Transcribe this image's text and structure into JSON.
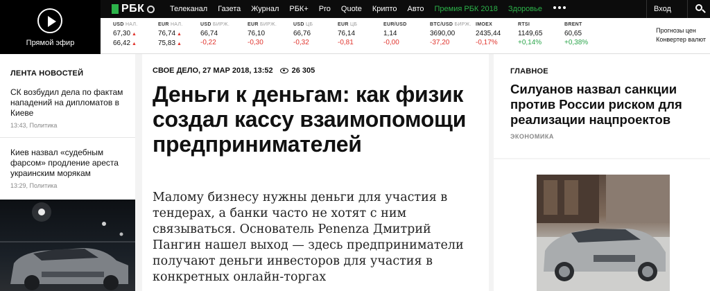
{
  "live": {
    "label": "Прямой эфир"
  },
  "brand": {
    "name": "РБК"
  },
  "nav": {
    "items": [
      "Телеканал",
      "Газета",
      "Журнал",
      "РБК+",
      "Pro",
      "Quote",
      "Крипто",
      "Авто"
    ],
    "promo": [
      "Премия РБК 2018",
      "Здоровье"
    ],
    "login": "Вход"
  },
  "ticker": [
    {
      "name": "USD",
      "src": "НАЛ.",
      "v1": "67,30",
      "v2": "66,42"
    },
    {
      "name": "EUR",
      "src": "НАЛ.",
      "v1": "76,74",
      "v2": "75,83"
    },
    {
      "name": "USD",
      "src": "БИРЖ.",
      "v1": "66,74",
      "v2": "-0,22"
    },
    {
      "name": "EUR",
      "src": "БИРЖ.",
      "v1": "76,10",
      "v2": "-0,30"
    },
    {
      "name": "USD",
      "src": "ЦБ",
      "v1": "66,76",
      "v2": "-0,32"
    },
    {
      "name": "EUR",
      "src": "ЦБ",
      "v1": "76,14",
      "v2": "-0,81"
    },
    {
      "name": "EUR/USD",
      "src": "",
      "v1": "1,14",
      "v2": "-0,00"
    },
    {
      "name": "BTC/USD",
      "src": "БИРЖ.",
      "v1": "3690,00",
      "v2": "-37,20"
    },
    {
      "name": "IMOEX",
      "src": "",
      "v1": "2435,44",
      "v2": "-0,17%"
    },
    {
      "name": "RTSI",
      "src": "",
      "v1": "1149,65",
      "v2": "+0,14%"
    },
    {
      "name": "BRENT",
      "src": "",
      "v1": "60,65",
      "v2": "+0,38%"
    }
  ],
  "tools": {
    "forecast": "Прогнозы цен",
    "converter": "Конвертер валют"
  },
  "feed": {
    "heading": "ЛЕНТА НОВОСТЕЙ",
    "items": [
      {
        "title": "СК возбудил дела по фактам нападений на дипломатов в Киеве",
        "meta": "13:43, Политика"
      },
      {
        "title": "Киев назвал «судебным фарсом» продление ареста украинским морякам",
        "meta": "13:29, Политика"
      }
    ]
  },
  "article": {
    "rubric_date": "СВОЕ ДЕЛО, 27 МАР 2018, 13:52",
    "views": "26 305",
    "title": "Деньги к деньгам: как физик создал кассу взаимопомощи предпринимателей",
    "lead": "Малому бизнесу нужны деньги для участия в тендерах, а банки часто не хотят с ним связываться. Основатель Penenza Дмитрий Пангин нашел выход — здесь предприниматели получают деньги инвесторов для участия в конкретных онлайн-торгах"
  },
  "main": {
    "heading": "ГЛАВНОЕ",
    "title": "Силуанов назвал санкции против России риском для реализации нацпроектов",
    "rubric": "ЭКОНОМИКА"
  }
}
